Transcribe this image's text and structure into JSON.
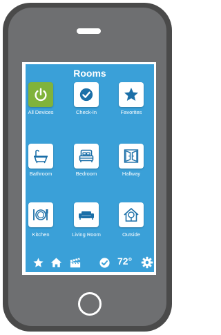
{
  "screen": {
    "title": "Rooms"
  },
  "tiles": [
    {
      "label": "All Devices",
      "icon": "power-icon",
      "active": true
    },
    {
      "label": "Check-In",
      "icon": "check-circle-icon"
    },
    {
      "label": "Favorites",
      "icon": "star-icon"
    },
    {
      "label": "Bathroom",
      "icon": "bathtub-icon"
    },
    {
      "label": "Bedroom",
      "icon": "bed-icon"
    },
    {
      "label": "Hallway",
      "icon": "doors-icon"
    },
    {
      "label": "Kitchen",
      "icon": "plate-utensils-icon"
    },
    {
      "label": "Living Room",
      "icon": "sofa-icon"
    },
    {
      "label": "Outside",
      "icon": "house-tree-icon"
    }
  ],
  "bottom_bar": {
    "icons": [
      "star-icon",
      "home-icon",
      "clapperboard-icon",
      "check-circle-icon",
      "gear-icon"
    ],
    "temperature": "72°"
  },
  "colors": {
    "screen_blue": "#3aa0d8",
    "tile_icon": "#1b6fa8",
    "active_tile": "#80b33b",
    "phone_body": "#4a4a4a"
  }
}
